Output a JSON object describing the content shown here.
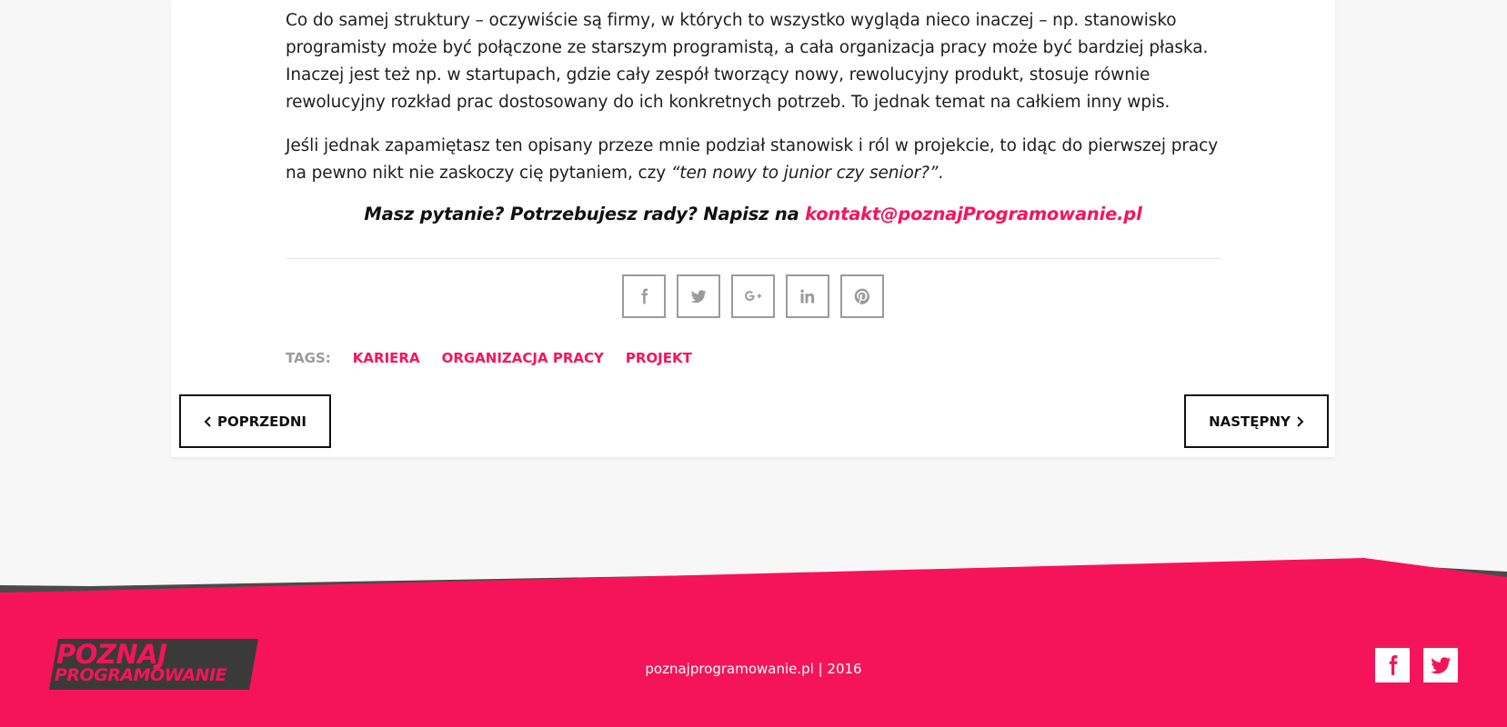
{
  "article": {
    "paragraphs": [
      "Co do samej struktury – oczywiście są firmy, w których to wszystko wygląda nieco inaczej – np. stanowisko programisty może być połączone ze starszym programistą, a cała organizacja pracy może być bardziej płaska. Inaczej jest też np. w startupach, gdzie cały zespół tworzący nowy, rewolucyjny produkt, stosuje równie rewolucyjny rozkład prac dostosowany do ich konkretnych potrzeb. To jednak temat na całkiem inny wpis."
    ],
    "closing_text": "Jeśli jednak zapamiętasz ten opisany przeze mnie podział stanowisk i ról w projekcie, to idąc do pierwszej pracy na pewno nikt nie zaskoczy cię pytaniem, czy ",
    "closing_quote": "“ten nowy to junior czy senior?”",
    "closing_end": ".",
    "cta_text": "Masz pytanie? Potrzebujesz rady? Napisz na ",
    "cta_email": "kontakt@poznajProgramowanie.pl"
  },
  "share": {
    "buttons": [
      {
        "icon": "facebook-icon"
      },
      {
        "icon": "twitter-icon"
      },
      {
        "icon": "google-plus-icon"
      },
      {
        "icon": "linkedin-icon"
      },
      {
        "icon": "pinterest-icon"
      }
    ]
  },
  "tags": {
    "label": "TAGS:",
    "items": [
      "KARIERA",
      "ORGANIZACJA PRACY",
      "PROJEKT"
    ]
  },
  "navigation": {
    "prev_label": "POPRZEDNI",
    "next_label": "NASTĘPNY"
  },
  "footer": {
    "logo_line1": "POZNAJ",
    "logo_line2": "PROGRAMOWANIE",
    "copyright": "poznajprogramowanie.pl | 2016",
    "social": [
      "facebook-icon",
      "twitter-icon"
    ]
  },
  "colors": {
    "accent": "#f5145a",
    "footer_dark": "#4a4a4a",
    "background": "#f7f7f7",
    "muted": "#9b9b9b"
  }
}
